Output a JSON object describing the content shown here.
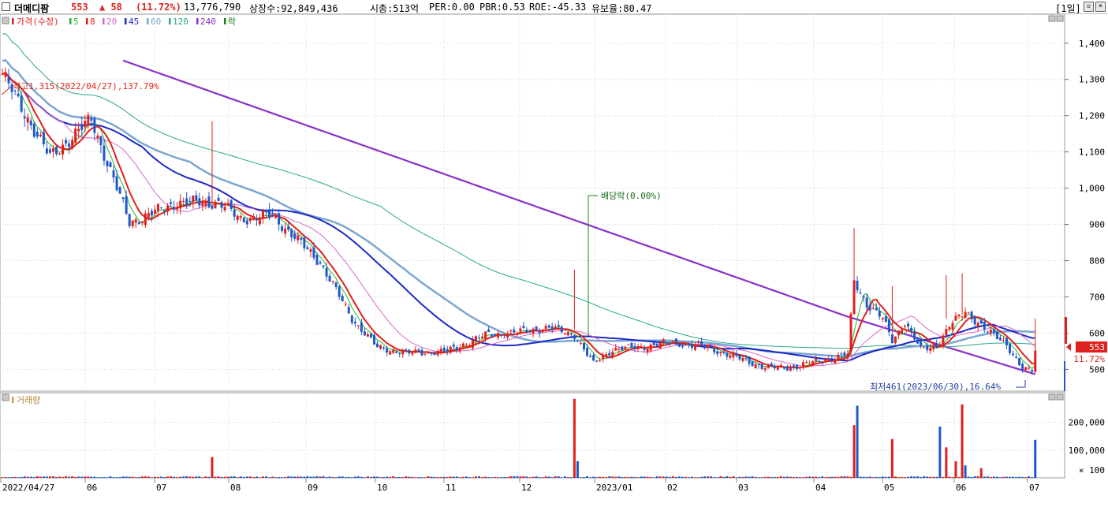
{
  "header": {
    "name": "더메디팜",
    "price": "553",
    "change": "▲ 58",
    "change_pct": "(11.72%)",
    "volume": "13,776,790",
    "listed_shares": "상장수:92,849,436",
    "market_cap": "시총:513억",
    "per": "PER:0.00",
    "pbr": "PBR:0.53",
    "roe": "ROE:-45.33",
    "float_rate": "유보율:80.47",
    "period": "[1일]",
    "icon_restore": "restore-icon",
    "icon_close": "close-icon"
  },
  "legend": {
    "price_label": "가격(수정)",
    "ma": [
      {
        "label": "5",
        "color": "#2bb52b"
      },
      {
        "label": "8",
        "color": "#e0201c"
      },
      {
        "label": "20",
        "color": "#d868c8"
      },
      {
        "label": "45",
        "color": "#1c28c8"
      },
      {
        "label": "60",
        "color": "#7aa6d0"
      },
      {
        "label": "120",
        "color": "#2aa888"
      },
      {
        "label": "240",
        "color": "#8a30c8"
      }
    ],
    "ex_label": "락",
    "volume_label": "거래량"
  },
  "annotations": {
    "high": "최고1,315(2022/04/27),137.79%",
    "low": "최저461(2023/06/30),16.64%",
    "dividend": "배당락(0.00%)",
    "price_badge": "553",
    "pct_badge": "11.72%"
  },
  "colors": {
    "up": "#e0201c",
    "down": "#1f58c8",
    "grid": "#d8d8d8",
    "panel_border": "#9a9a9a"
  },
  "chart_data": {
    "type": "candlestick",
    "y_ticks": [
      500,
      600,
      700,
      800,
      900,
      "1,000",
      "1,100",
      "1,200",
      "1,300",
      "1,400"
    ],
    "ylim": [
      440,
      1480
    ],
    "volume_ticks": [
      "200,000",
      "100,000"
    ],
    "volume_unit": "× 100",
    "volume_ylim": [
      0,
      290000
    ],
    "x_labels": [
      "2022/04/27",
      "06",
      "07",
      "08",
      "09",
      "10",
      "11",
      "12",
      "2023/01",
      "02",
      "03",
      "04",
      "05",
      "06",
      "07"
    ],
    "key_points": [
      {
        "t": 0,
        "close": 1315
      },
      {
        "t": 15,
        "close": 1085
      },
      {
        "t": 28,
        "close": 1190
      },
      {
        "t": 40,
        "close": 905
      },
      {
        "t": 55,
        "close": 960
      },
      {
        "t": 68,
        "close": 960
      },
      {
        "t": 75,
        "close": 915
      },
      {
        "t": 85,
        "close": 925
      },
      {
        "t": 100,
        "close": 795
      },
      {
        "t": 110,
        "close": 640
      },
      {
        "t": 118,
        "close": 560
      },
      {
        "t": 128,
        "close": 545
      },
      {
        "t": 140,
        "close": 550
      },
      {
        "t": 152,
        "close": 595
      },
      {
        "t": 160,
        "close": 600
      },
      {
        "t": 172,
        "close": 615
      },
      {
        "t": 180,
        "close": 595
      },
      {
        "t": 186,
        "close": 515
      },
      {
        "t": 192,
        "close": 555
      },
      {
        "t": 200,
        "close": 560
      },
      {
        "t": 210,
        "close": 575
      },
      {
        "t": 222,
        "close": 560
      },
      {
        "t": 232,
        "close": 530
      },
      {
        "t": 240,
        "close": 505
      },
      {
        "t": 248,
        "close": 505
      },
      {
        "t": 258,
        "close": 525
      },
      {
        "t": 266,
        "close": 540
      },
      {
        "t": 268,
        "close": 745
      },
      {
        "t": 272,
        "close": 680
      },
      {
        "t": 277,
        "close": 640
      },
      {
        "t": 280,
        "close": 580
      },
      {
        "t": 284,
        "close": 630
      },
      {
        "t": 289,
        "close": 555
      },
      {
        "t": 294,
        "close": 565
      },
      {
        "t": 298,
        "close": 620
      },
      {
        "t": 303,
        "close": 660
      },
      {
        "t": 310,
        "close": 605
      },
      {
        "t": 316,
        "close": 570
      },
      {
        "t": 321,
        "close": 500
      },
      {
        "t": 324,
        "close": 495
      },
      {
        "t": 325,
        "close": 553
      }
    ],
    "volume_spikes": [
      {
        "t": 66,
        "value": 75000,
        "dir": "up"
      },
      {
        "t": 180,
        "value": 285000,
        "dir": "up"
      },
      {
        "t": 181,
        "value": 60000,
        "dir": "down"
      },
      {
        "t": 268,
        "value": 190000,
        "dir": "up"
      },
      {
        "t": 269,
        "value": 260000,
        "dir": "down"
      },
      {
        "t": 280,
        "value": 140000,
        "dir": "up"
      },
      {
        "t": 295,
        "value": 185000,
        "dir": "down"
      },
      {
        "t": 297,
        "value": 110000,
        "dir": "up"
      },
      {
        "t": 300,
        "value": 60000,
        "dir": "up"
      },
      {
        "t": 302,
        "value": 265000,
        "dir": "up"
      },
      {
        "t": 303,
        "value": 45000,
        "dir": "down"
      },
      {
        "t": 308,
        "value": 35000,
        "dir": "up"
      },
      {
        "t": 325,
        "value": 137000,
        "dir": "down"
      }
    ]
  }
}
